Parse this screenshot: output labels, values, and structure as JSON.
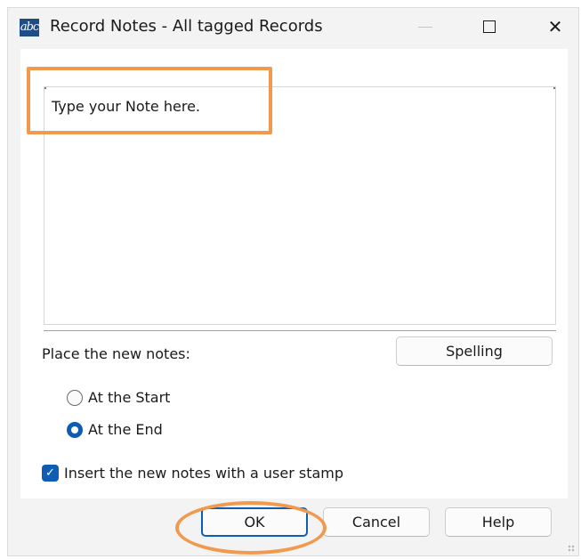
{
  "window": {
    "title": "Record Notes - All tagged Records",
    "app_icon": "abc-notes-icon",
    "controls": [
      "minimize-icon",
      "maximize-icon",
      "close-icon"
    ]
  },
  "notes": {
    "text": "Type your Note here."
  },
  "placement": {
    "label": "Place the new notes:",
    "options": [
      {
        "label": "At the Start",
        "checked": false
      },
      {
        "label": "At the End",
        "checked": true
      }
    ]
  },
  "spelling_label": "Spelling",
  "user_stamp": {
    "label": "Insert the new notes with a user stamp",
    "checked": true
  },
  "buttons": {
    "ok": "OK",
    "cancel": "Cancel",
    "help": "Help"
  },
  "colors": {
    "accent": "#0f5cb5",
    "annotation": "#f19a4e"
  }
}
